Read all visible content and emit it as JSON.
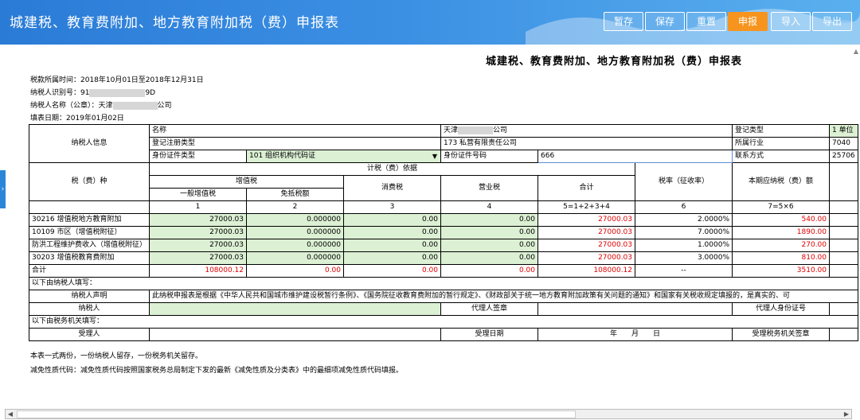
{
  "header": {
    "title": "城建税、教育费附加、地方教育附加税（费）申报表",
    "buttons": [
      "暂存",
      "保存",
      "重置",
      "申报",
      "导入",
      "导出"
    ]
  },
  "doc": {
    "title": "城建税、教育费附加、地方教育附加税（费）申报表",
    "period": "税款所属时间：2018年10月01日至2018年12月31日",
    "taxpayer_id_prefix": "纳税人识别号：91",
    "taxpayer_id_suffix": "9D",
    "taxpayer_name_prefix": "纳税人名称（公章）：天津",
    "taxpayer_name_suffix": "公司",
    "fill_date": "填表日期：2019年01月02日"
  },
  "info": {
    "section_label": "纳税人信息",
    "name_label": "名称",
    "name_value_prefix": "天津",
    "name_value_suffix": "公司",
    "reg_type_label": "登记类型",
    "reg_type_value": "1 单位",
    "reg_reg_label": "登记注册类型",
    "reg_reg_value": "173 私营有限责任公司",
    "industry_label": "所属行业",
    "industry_value": "7040",
    "idtype_label": "身份证件类型",
    "idtype_value": "101 组织机构代码证",
    "idno_label": "身份证件号码",
    "idno_value": "666",
    "contact_label": "联系方式",
    "contact_value": "25706"
  },
  "table": {
    "tax_type_label": "税（费）种",
    "basis_label": "计税（费）依据",
    "vat_label": "增值税",
    "general_vat_label": "一般增值税",
    "exempt_label": "免抵税额",
    "consumption_label": "消费税",
    "business_label": "营业税",
    "total_label": "合计",
    "rate_label": "税率（征收率）",
    "payable_label": "本期应纳税（费）额",
    "col_nums": [
      "1",
      "2",
      "3",
      "4",
      "5=1+2+3+4",
      "6",
      "7=5×6"
    ],
    "rows": [
      {
        "name": "30216 增值税地方教育附加",
        "c1": "27000.03",
        "c2": "0.000000",
        "c3": "0.00",
        "c4": "0.00",
        "c5": "27000.03",
        "c6": "2.0000%",
        "c7": "540.00"
      },
      {
        "name": "10109 市区（增值税附征）",
        "c1": "27000.03",
        "c2": "0.000000",
        "c3": "0.00",
        "c4": "0.00",
        "c5": "27000.03",
        "c6": "7.0000%",
        "c7": "1890.00"
      },
      {
        "name": "防洪工程维护费收入（增值税附征）",
        "c1": "27000.03",
        "c2": "0.000000",
        "c3": "0.00",
        "c4": "0.00",
        "c5": "27000.03",
        "c6": "1.0000%",
        "c7": "270.00"
      },
      {
        "name": "30203 增值税教育费附加",
        "c1": "27000.03",
        "c2": "0.000000",
        "c3": "0.00",
        "c4": "0.00",
        "c5": "27000.03",
        "c6": "3.0000%",
        "c7": "810.00"
      }
    ],
    "sum": {
      "name": "合计",
      "c1": "108000.12",
      "c2": "0.00",
      "c3": "0.00",
      "c4": "0.00",
      "c5": "108000.12",
      "c6": "--",
      "c7": "3510.00"
    }
  },
  "footer_rows": {
    "taxpayer_fill": "以下由纳税人填写：",
    "declaration_label": "纳税人声明",
    "declaration_text": "此纳税申报表是根据《中华人民共和国城市维护建设税暂行条例》、《国务院征收教育费附加的暂行规定》、《财政部关于统一地方教育附加政策有关问题的通知》和国家有关税收规定填报的，是真实的、可",
    "taxpayer_label": "纳税人",
    "agent_sign_label": "代理人签章",
    "agent_id_label": "代理人身份证号",
    "authority_fill": "以下由税务机关填写：",
    "acceptor_label": "受理人",
    "accept_date_label": "受理日期",
    "date_text": "年　　月　　日",
    "authority_sign_label": "受理税务机关签章"
  },
  "notes": {
    "line1": "本表一式两份，一份纳税人留存，一份税务机关留存。",
    "line2": "减免性质代码：减免性质代码按照国家税务总局制定下发的最新《减免性质及分类表》中的最细项减免性质代码填报。"
  }
}
